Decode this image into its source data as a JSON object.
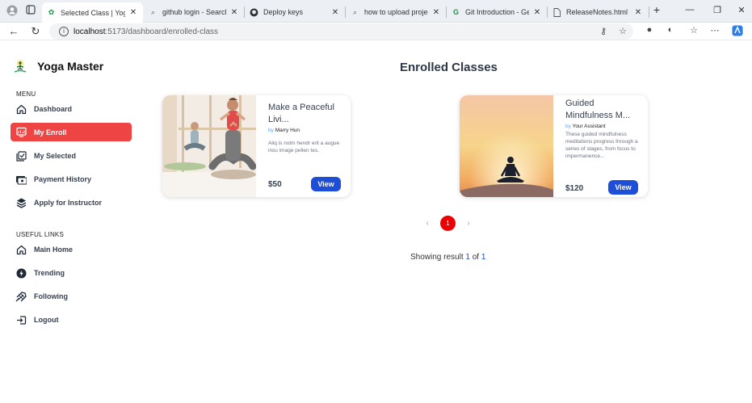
{
  "browser": {
    "tabs": [
      {
        "title": "Selected Class | Yoga Maste",
        "icon": "yoga-favicon",
        "active": true
      },
      {
        "title": "github login - Search",
        "icon": "search-favicon",
        "active": false
      },
      {
        "title": "Deploy keys",
        "icon": "github-favicon",
        "active": false
      },
      {
        "title": "how to upload project on gi",
        "icon": "search-favicon",
        "active": false
      },
      {
        "title": "Git Introduction - Geeksfor",
        "icon": "gfg-favicon",
        "active": false
      },
      {
        "title": "ReleaseNotes.html",
        "icon": "file-favicon",
        "active": false
      }
    ],
    "new_tab": "+",
    "url_host": "localhost",
    "url_path": ":5173/dashboard/enrolled-class"
  },
  "sidebar": {
    "brand": "Yoga Master",
    "menu_heading": "MENU",
    "menu": [
      {
        "label": "Dashboard",
        "icon": "home-icon",
        "active": false
      },
      {
        "label": "My Enroll",
        "icon": "enroll-icon",
        "active": true
      },
      {
        "label": "My Selected",
        "icon": "selected-icon",
        "active": false
      },
      {
        "label": "Payment History",
        "icon": "payment-icon",
        "active": false
      },
      {
        "label": "Apply for Instructor",
        "icon": "instructor-icon",
        "active": false
      }
    ],
    "links_heading": "USEFUL LINKS",
    "links": [
      {
        "label": "Main Home",
        "icon": "home-icon"
      },
      {
        "label": "Trending",
        "icon": "trending-icon"
      },
      {
        "label": "Following",
        "icon": "following-icon"
      },
      {
        "label": "Logout",
        "icon": "logout-icon"
      }
    ]
  },
  "main": {
    "title": "Enrolled Classes",
    "classes": [
      {
        "title": "Make a Peaceful Livi...",
        "by_prefix": "by",
        "instructor": "Marry Hun",
        "description": "Aliq is notm hendr erit a augue insu image pellen tes.",
        "price": "$50",
        "view_label": "View"
      },
      {
        "title": "Guided Mindfulness M...",
        "by_prefix": "by",
        "instructor": "Your Assistant",
        "description": "These guided mindfulness meditations progress through a series of stages, from focus to impermanence...",
        "price": "$120",
        "view_label": "View"
      }
    ],
    "pagination": {
      "prev": "‹",
      "current": "1",
      "next": "›"
    },
    "result": {
      "prefix": "Showing result",
      "current": "1",
      "of": "of",
      "total": "1"
    }
  },
  "colors": {
    "accent_red": "#ef4444",
    "primary_blue": "#1d4ed8",
    "page_dot": "#ef0000"
  }
}
